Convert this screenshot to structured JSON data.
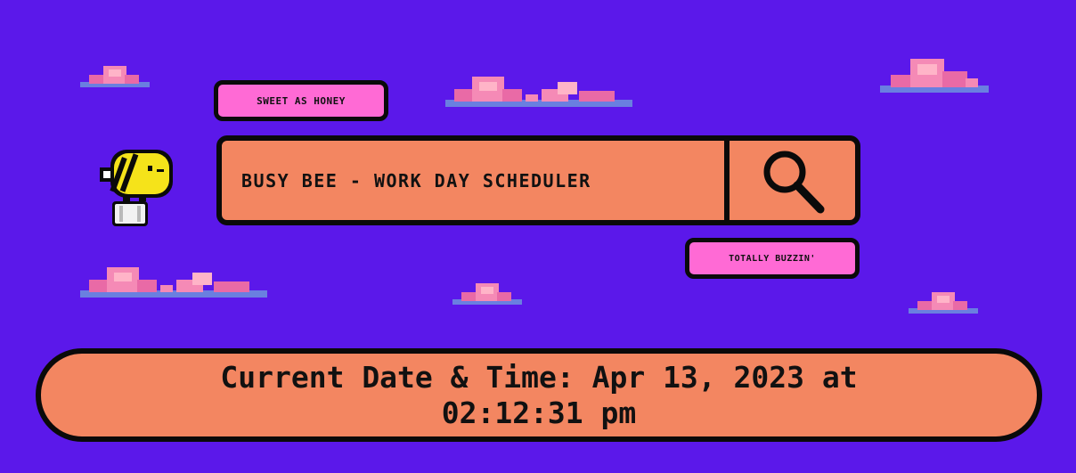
{
  "tags": {
    "top": "SWEET AS HONEY",
    "bottom": "TOTALLY BUZZIN'"
  },
  "search": {
    "text": "BUSY BEE - WORK DAY SCHEDULER",
    "icon": "magnifier-icon"
  },
  "datetime": {
    "line1": "Current Date & Time: Apr 13, 2023 at",
    "line2": "02:12:31 pm"
  },
  "colors": {
    "background": "#5b18ea",
    "panel": "#f38661",
    "tag": "#ff6ad5",
    "outline": "#0a0a0a"
  }
}
